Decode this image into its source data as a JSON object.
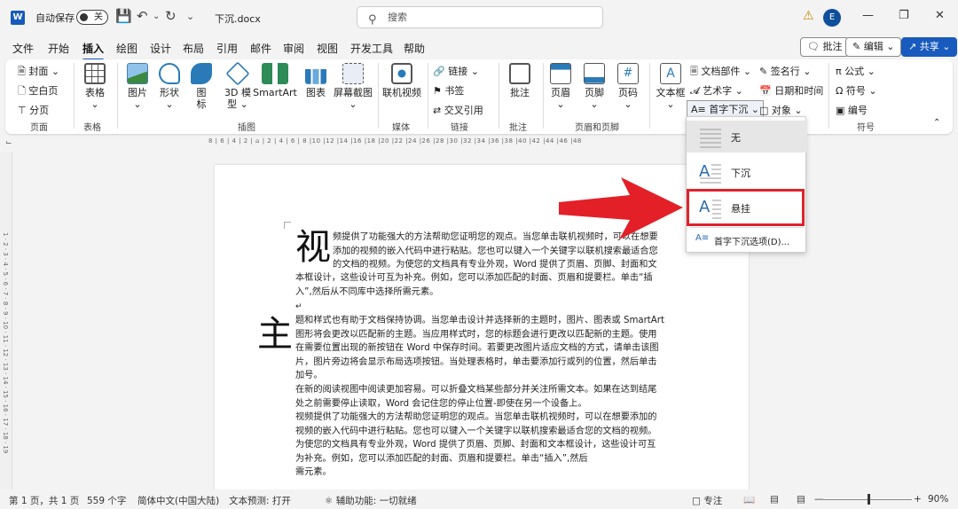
{
  "titlebar": {
    "autosave_label": "自动保存",
    "autosave_state": "关",
    "doc_title": "下沉.docx",
    "search_placeholder": "搜索",
    "user_initial": "E"
  },
  "menu": {
    "tabs": [
      "文件",
      "开始",
      "插入",
      "绘图",
      "设计",
      "布局",
      "引用",
      "邮件",
      "审阅",
      "视图",
      "开发工具",
      "帮助"
    ],
    "active": "插入",
    "comment_button": "批注",
    "edit_button": "编辑",
    "share_button": "共享"
  },
  "ribbon": {
    "pages": {
      "cover": "封面",
      "blank": "空白页",
      "break": "分页",
      "group": "页面"
    },
    "table": {
      "label": "表格",
      "group": "表格"
    },
    "illustrations": {
      "picture": "图片",
      "shapes": "形状",
      "icons_1": "图",
      "icons_2": "标",
      "model_1": "3D 模",
      "model_2": "型",
      "smartart": "SmartArt",
      "chart": "图表",
      "screenshot": "屏幕截图",
      "group": "插图"
    },
    "media": {
      "video": "联机视频",
      "group": "媒体"
    },
    "links": {
      "link": "链接",
      "bookmark": "书签",
      "crossref": "交叉引用",
      "group": "链接"
    },
    "comments": {
      "comment": "批注",
      "group": "批注"
    },
    "headerfooter": {
      "header": "页眉",
      "footer": "页脚",
      "pagenum": "页码",
      "group": "页眉和页脚"
    },
    "text": {
      "textbox": "文本框",
      "parts": "文档部件",
      "wordart": "艺术字",
      "dropcap": "首字下沉",
      "signature": "签名行",
      "datetime": "日期和时间",
      "object": "对象"
    },
    "symbols": {
      "equation": "公式",
      "symbol": "符号",
      "number": "编号",
      "group": "符号"
    }
  },
  "dropdown": {
    "none": "无",
    "dropped": "下沉",
    "margin": "悬挂",
    "options": "首字下沉选项(D)..."
  },
  "ruler_text": "8 | 6 | 4 | 2 | ⌂ | 2 | 4 | 6 | 8 |10 |12 |14 |16 |18 |20 |22 |24 |26 |28 |30 |32 |34 |36 |38 |40 |42 |44 |46 |48",
  "vruler_text": "1 · 2 · 3 · 4 · 5 · 6 · 7 · 8 · 9 · 10 · 11 · 12 · 13 · 14 · 15 · 16 · 17 · 18 · 19",
  "document": {
    "dropcap1": "视",
    "para1_lines": [
      "频提供了功能强大的方法帮助您证明您的观点。当您单击联机视频时，可以在想要",
      "添加的视频的嵌入代码中进行粘贴。您也可以键入一个关键字以联机搜索最适合您",
      "的文档的视频。为使您的文档具有专业外观，Word 提供了页眉、页脚、封面和文",
      "本框设计，这些设计可互为补充。例如，您可以添加匹配的封面、页眉和提要栏。单击“插",
      "入”,然后从不同库中选择所需元素。"
    ],
    "return_mark": "↵",
    "dropcap2": "主",
    "para2_lines": [
      "题和样式也有助于文档保持协调。当您单击设计并选择新的主题时，图片、图表或 SmartArt",
      "图形将会更改以匹配新的主题。当应用样式时，您的标题会进行更改以匹配新的主题。使用",
      "在需要位置出现的新按钮在 Word 中保存时间。若要更改图片适应文档的方式，请单击该图",
      "片，图片旁边将会显示布局选项按钮。当处理表格时，单击要添加行或列的位置，然后单击",
      "加号。"
    ],
    "para3_lines": [
      "在新的阅读视图中阅读更加容易。可以折叠文档某些部分并关注所需文本。如果在达到结尾",
      "处之前需要停止读取，Word 会记住您的停止位置-即使在另一个设备上。",
      "视频提供了功能强大的方法帮助您证明您的观点。当您单击联机视频时，可以在想要添加的",
      "视频的嵌入代码中进行粘贴。您也可以键入一个关键字以联机搜索最适合您的文档的视频。",
      "为使您的文档具有专业外观，Word 提供了页眉、页脚、封面和文本框设计，这些设计可互",
      "为补充。例如，您可以添加匹配的封面、页眉和提要栏。单击“插入”,然后",
      "需元素。"
    ]
  },
  "status": {
    "page": "第 1 页，共 1 页",
    "words": "559 个字",
    "language": "简体中文(中国大陆)",
    "prediction": "文本预测: 打开",
    "accessibility": "辅助功能: 一切就绪",
    "focus": "专注",
    "zoom": "90%"
  },
  "colors": {
    "accent": "#185abd",
    "highlight": "#e0222c",
    "arrow": "#e32027"
  }
}
